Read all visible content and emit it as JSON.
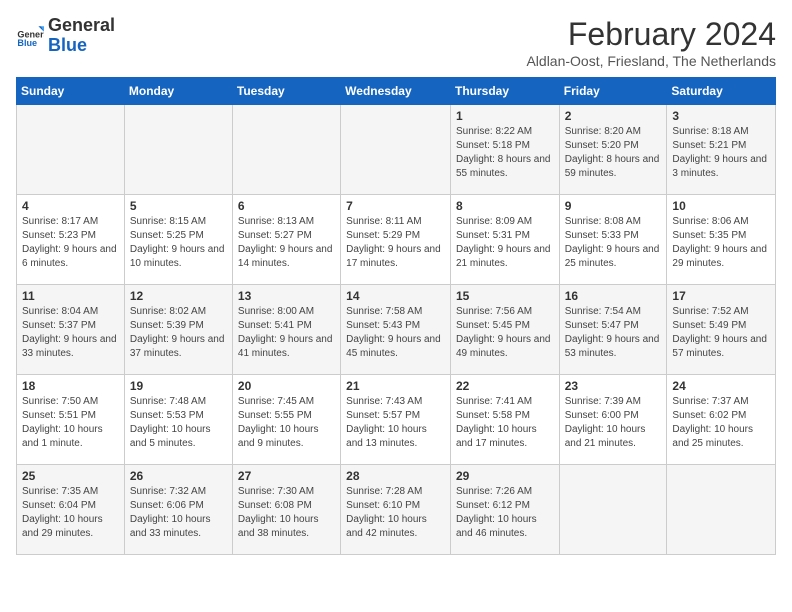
{
  "logo": {
    "line1": "General",
    "line2": "Blue"
  },
  "header": {
    "month_year": "February 2024",
    "location": "Aldlan-Oost, Friesland, The Netherlands"
  },
  "weekdays": [
    "Sunday",
    "Monday",
    "Tuesday",
    "Wednesday",
    "Thursday",
    "Friday",
    "Saturday"
  ],
  "weeks": [
    [
      {
        "day": "",
        "info": ""
      },
      {
        "day": "",
        "info": ""
      },
      {
        "day": "",
        "info": ""
      },
      {
        "day": "",
        "info": ""
      },
      {
        "day": "1",
        "info": "Sunrise: 8:22 AM\nSunset: 5:18 PM\nDaylight: 8 hours and 55 minutes."
      },
      {
        "day": "2",
        "info": "Sunrise: 8:20 AM\nSunset: 5:20 PM\nDaylight: 8 hours and 59 minutes."
      },
      {
        "day": "3",
        "info": "Sunrise: 8:18 AM\nSunset: 5:21 PM\nDaylight: 9 hours and 3 minutes."
      }
    ],
    [
      {
        "day": "4",
        "info": "Sunrise: 8:17 AM\nSunset: 5:23 PM\nDaylight: 9 hours and 6 minutes."
      },
      {
        "day": "5",
        "info": "Sunrise: 8:15 AM\nSunset: 5:25 PM\nDaylight: 9 hours and 10 minutes."
      },
      {
        "day": "6",
        "info": "Sunrise: 8:13 AM\nSunset: 5:27 PM\nDaylight: 9 hours and 14 minutes."
      },
      {
        "day": "7",
        "info": "Sunrise: 8:11 AM\nSunset: 5:29 PM\nDaylight: 9 hours and 17 minutes."
      },
      {
        "day": "8",
        "info": "Sunrise: 8:09 AM\nSunset: 5:31 PM\nDaylight: 9 hours and 21 minutes."
      },
      {
        "day": "9",
        "info": "Sunrise: 8:08 AM\nSunset: 5:33 PM\nDaylight: 9 hours and 25 minutes."
      },
      {
        "day": "10",
        "info": "Sunrise: 8:06 AM\nSunset: 5:35 PM\nDaylight: 9 hours and 29 minutes."
      }
    ],
    [
      {
        "day": "11",
        "info": "Sunrise: 8:04 AM\nSunset: 5:37 PM\nDaylight: 9 hours and 33 minutes."
      },
      {
        "day": "12",
        "info": "Sunrise: 8:02 AM\nSunset: 5:39 PM\nDaylight: 9 hours and 37 minutes."
      },
      {
        "day": "13",
        "info": "Sunrise: 8:00 AM\nSunset: 5:41 PM\nDaylight: 9 hours and 41 minutes."
      },
      {
        "day": "14",
        "info": "Sunrise: 7:58 AM\nSunset: 5:43 PM\nDaylight: 9 hours and 45 minutes."
      },
      {
        "day": "15",
        "info": "Sunrise: 7:56 AM\nSunset: 5:45 PM\nDaylight: 9 hours and 49 minutes."
      },
      {
        "day": "16",
        "info": "Sunrise: 7:54 AM\nSunset: 5:47 PM\nDaylight: 9 hours and 53 minutes."
      },
      {
        "day": "17",
        "info": "Sunrise: 7:52 AM\nSunset: 5:49 PM\nDaylight: 9 hours and 57 minutes."
      }
    ],
    [
      {
        "day": "18",
        "info": "Sunrise: 7:50 AM\nSunset: 5:51 PM\nDaylight: 10 hours and 1 minute."
      },
      {
        "day": "19",
        "info": "Sunrise: 7:48 AM\nSunset: 5:53 PM\nDaylight: 10 hours and 5 minutes."
      },
      {
        "day": "20",
        "info": "Sunrise: 7:45 AM\nSunset: 5:55 PM\nDaylight: 10 hours and 9 minutes."
      },
      {
        "day": "21",
        "info": "Sunrise: 7:43 AM\nSunset: 5:57 PM\nDaylight: 10 hours and 13 minutes."
      },
      {
        "day": "22",
        "info": "Sunrise: 7:41 AM\nSunset: 5:58 PM\nDaylight: 10 hours and 17 minutes."
      },
      {
        "day": "23",
        "info": "Sunrise: 7:39 AM\nSunset: 6:00 PM\nDaylight: 10 hours and 21 minutes."
      },
      {
        "day": "24",
        "info": "Sunrise: 7:37 AM\nSunset: 6:02 PM\nDaylight: 10 hours and 25 minutes."
      }
    ],
    [
      {
        "day": "25",
        "info": "Sunrise: 7:35 AM\nSunset: 6:04 PM\nDaylight: 10 hours and 29 minutes."
      },
      {
        "day": "26",
        "info": "Sunrise: 7:32 AM\nSunset: 6:06 PM\nDaylight: 10 hours and 33 minutes."
      },
      {
        "day": "27",
        "info": "Sunrise: 7:30 AM\nSunset: 6:08 PM\nDaylight: 10 hours and 38 minutes."
      },
      {
        "day": "28",
        "info": "Sunrise: 7:28 AM\nSunset: 6:10 PM\nDaylight: 10 hours and 42 minutes."
      },
      {
        "day": "29",
        "info": "Sunrise: 7:26 AM\nSunset: 6:12 PM\nDaylight: 10 hours and 46 minutes."
      },
      {
        "day": "",
        "info": ""
      },
      {
        "day": "",
        "info": ""
      }
    ]
  ]
}
